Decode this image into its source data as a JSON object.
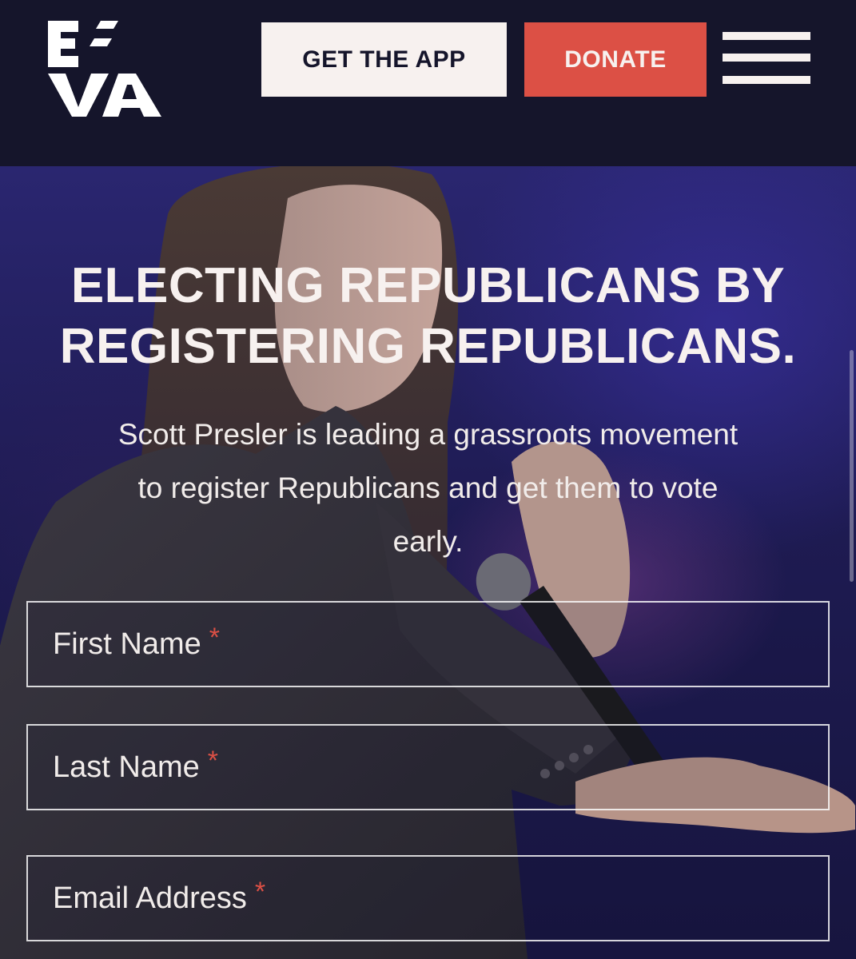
{
  "header": {
    "logo_text": "EVA",
    "get_app_label": "GET THE APP",
    "donate_label": "DONATE",
    "menu_icon": "hamburger-menu-icon"
  },
  "hero": {
    "headline_line1": "ELECTING REPUBLICANS BY",
    "headline_line2": "REGISTERING REPUBLICANS.",
    "subtext_line1": "Scott Presler is leading a grassroots movement",
    "subtext_line2": "to register Republicans and get them to vote",
    "subtext_line3": "early."
  },
  "form": {
    "fields": [
      {
        "label": "First Name",
        "required_mark": "*"
      },
      {
        "label": "Last Name",
        "required_mark": "*"
      },
      {
        "label": "Email Address",
        "required_mark": "*"
      }
    ]
  },
  "colors": {
    "header_bg": "#15152b",
    "accent_red": "#dc5045",
    "light": "#f7f1ef",
    "hero_purple": "#2a2670"
  }
}
